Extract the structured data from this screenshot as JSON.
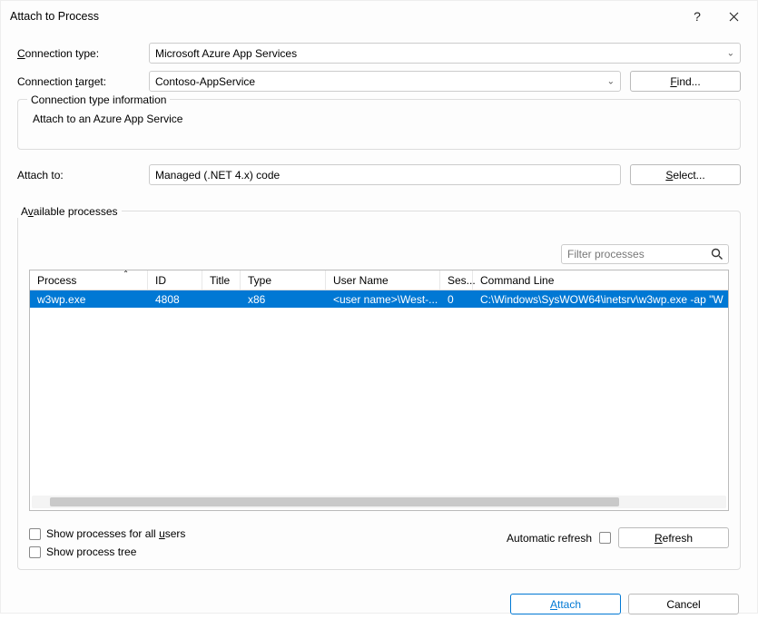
{
  "title": "Attach to Process",
  "labels": {
    "conn_type_pre": "C",
    "conn_type_post": "onnection type:",
    "conn_target_pre": "Connection ",
    "conn_target_u": "t",
    "conn_target_post": "arget:",
    "conn_info": "Connection type information",
    "conn_info_detail": "Attach to an Azure App Service",
    "attach_to": "Attach to:",
    "available_pre": "A",
    "available_u": "v",
    "available_post": "ailable processes",
    "show_all_pre": "Show processes for all ",
    "show_all_u": "u",
    "show_all_post": "sers",
    "show_tree": "Show process tree",
    "auto_refresh": "Automatic refresh"
  },
  "conn_type": "Microsoft Azure App Services",
  "conn_target": "Contoso-AppService",
  "attach_value": "Managed (.NET 4.x) code",
  "filter_placeholder": "Filter processes",
  "columns": {
    "process": "Process",
    "id": "ID",
    "title": "Title",
    "type": "Type",
    "user": "User Name",
    "session": "Ses...",
    "cmd": "Command Line"
  },
  "row": {
    "process": "w3wp.exe",
    "id": "4808",
    "title": "",
    "type": "x86",
    "user": "<user name>\\West-...",
    "session": "0",
    "cmd": "C:\\Windows\\SysWOW64\\inetsrv\\w3wp.exe -ap \"W"
  },
  "buttons": {
    "find_pre": "",
    "find_u": "F",
    "find_post": "ind...",
    "select_pre": "",
    "select_u": "S",
    "select_post": "elect...",
    "refresh_pre": "",
    "refresh_u": "R",
    "refresh_post": "efresh",
    "attach_pre": "",
    "attach_u": "A",
    "attach_post": "ttach",
    "cancel": "Cancel"
  }
}
